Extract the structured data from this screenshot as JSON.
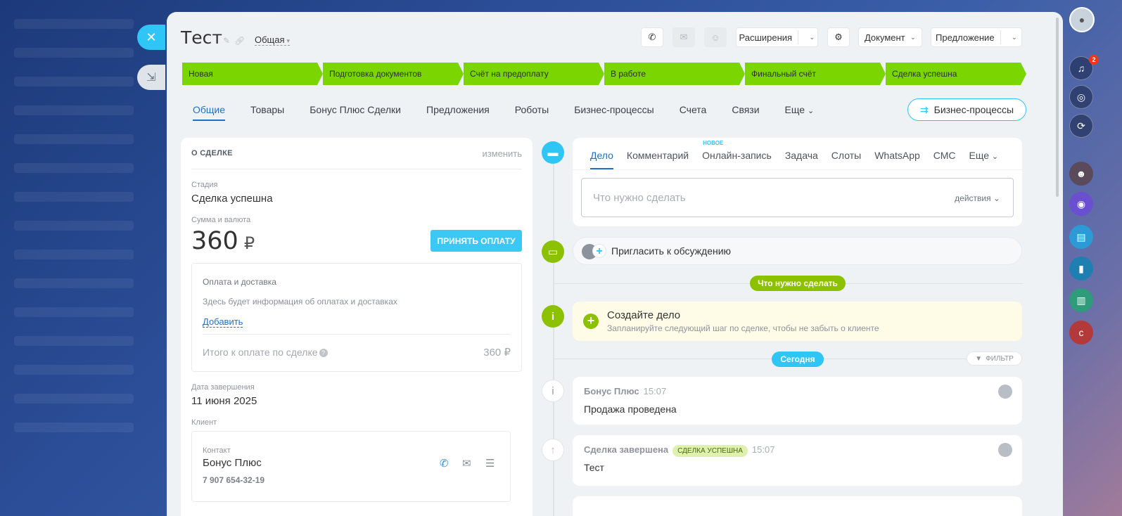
{
  "deal": {
    "title": "Тест",
    "category": "Общая"
  },
  "header": {
    "extensions_label": "Расширения",
    "document_label": "Документ",
    "proposal_label": "Предложение"
  },
  "stages": [
    "Новая",
    "Подготовка документов",
    "Счёт на предоплату",
    "В работе",
    "Финальный счёт",
    "Сделка успешна"
  ],
  "tabs": [
    "Общие",
    "Товары",
    "Бонус Плюс Сделки",
    "Предложения",
    "Роботы",
    "Бизнес-процессы",
    "Счета",
    "Связи",
    "Еще"
  ],
  "bp_button_label": "Бизнес-процессы",
  "about": {
    "header": "О СДЕЛКЕ",
    "edit_label": "изменить",
    "stage_label": "Стадия",
    "stage_value": "Сделка успешна",
    "amount_label": "Сумма и валюта",
    "amount_value": "360",
    "currency": "₽",
    "pay_button": "ПРИНЯТЬ ОПЛАТУ",
    "payment": {
      "title": "Оплата и доставка",
      "description": "Здесь будет информация об оплатах и доставках",
      "add_link": "Добавить",
      "total_label": "Итого к оплате по сделке",
      "total_value": "360 ₽"
    },
    "close_date_label": "Дата завершения",
    "close_date_value": "11 июня 2025",
    "client_label": "Клиент",
    "contact": {
      "type": "Контакт",
      "name": "Бонус Плюс",
      "phone": "7 907 654-32-19"
    }
  },
  "editor": {
    "tabs": [
      "Дело",
      "Комментарий",
      "Онлайн-запись",
      "Задача",
      "Слоты",
      "WhatsApp",
      "СМС",
      "Еще"
    ],
    "new_badge": "НОВОЕ",
    "placeholder": "Что нужно сделать",
    "actions_label": "действия"
  },
  "invite_label": "Пригласить к обсуждению",
  "todo_pill": "Что нужно сделать",
  "todo": {
    "title": "Создайте дело",
    "subtitle": "Запланируйте следующий шаг по сделке, чтобы не забыть о клиенте"
  },
  "today_pill": "Сегодня",
  "filter_label": "ФИЛЬТР",
  "feed": [
    {
      "who": "Бонус Плюс",
      "time": "15:07",
      "body": "Продажа проведена"
    },
    {
      "who": "Сделка завершена",
      "badge": "СДЕЛКА УСПЕШНА",
      "time": "15:07",
      "body": "Тест"
    }
  ],
  "notifications_count": "2",
  "colors": {
    "accent": "#2fc6f6",
    "stage_green": "#7bd500",
    "timeline_green": "#8cc100",
    "link_blue": "#1f6fc5"
  }
}
